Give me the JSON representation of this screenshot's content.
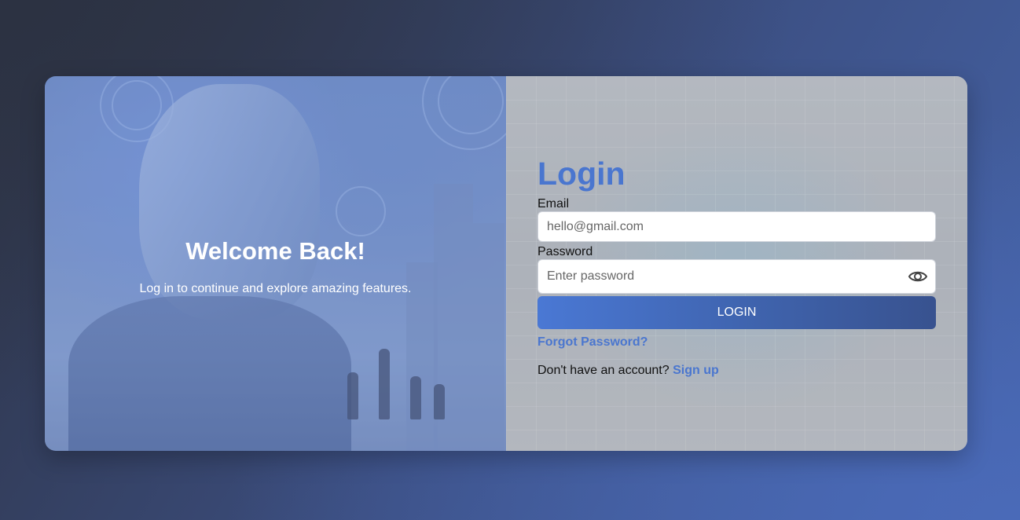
{
  "hero": {
    "title": "Welcome Back!",
    "subtitle": "Log in to continue and explore amazing features."
  },
  "login": {
    "title": "Login",
    "email_label": "Email",
    "email_placeholder": "hello@gmail.com",
    "password_label": "Password",
    "password_placeholder": "Enter password",
    "submit_label": "LOGIN",
    "forgot_label": "Forgot Password?",
    "signup_prompt": "Don't have an account?",
    "signup_label": "Sign up"
  },
  "icons": {
    "password_toggle": "eye-icon"
  },
  "colors": {
    "accent": "#4a76cf",
    "button_start": "#4a78d4",
    "button_end": "#38528f"
  }
}
